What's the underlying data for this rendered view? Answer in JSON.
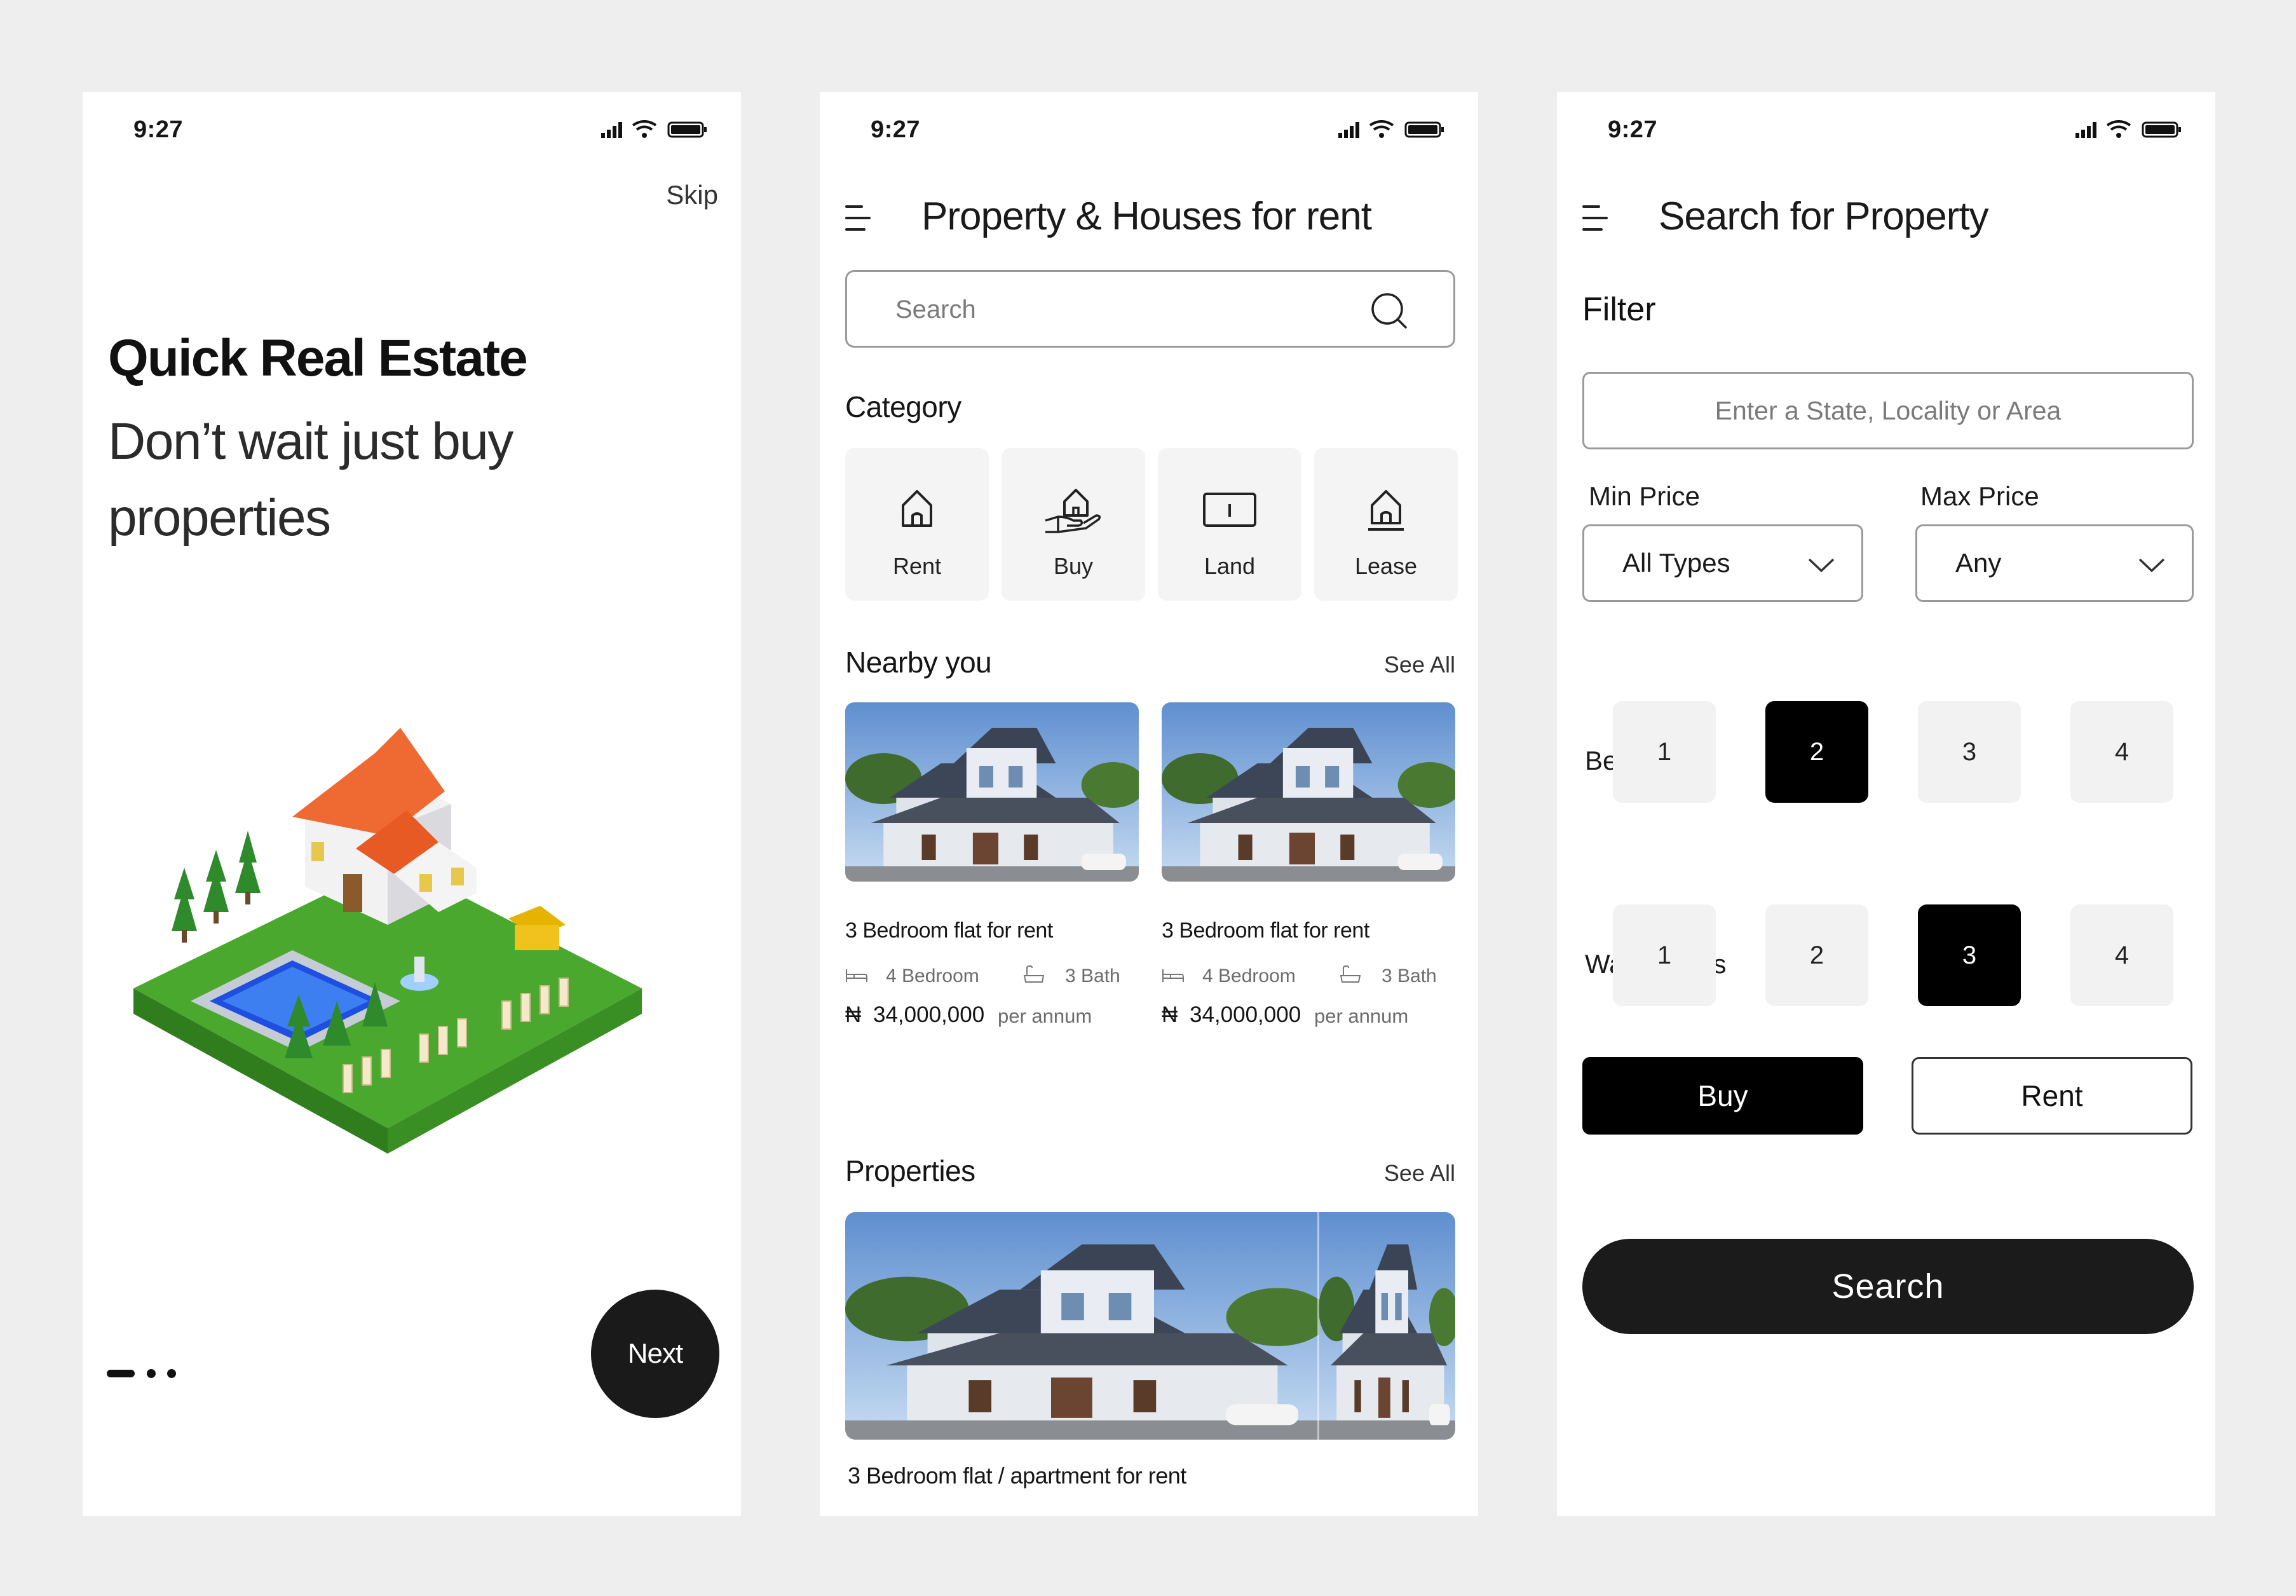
{
  "onboarding": {
    "time": "9:27",
    "skip_label": "Skip",
    "title": "Quick Real Estate",
    "subtitle": "Don’t wait just buy properties",
    "next_label": "Next",
    "page_indicator": {
      "current": 1,
      "total": 3
    }
  },
  "listing": {
    "time": "9:27",
    "title": "Property & Houses for rent",
    "search_placeholder": "Search",
    "category_title": "Category",
    "categories": [
      {
        "label": "Rent",
        "icon": "house-icon"
      },
      {
        "label": "Buy",
        "icon": "hand-house-icon"
      },
      {
        "label": "Land",
        "icon": "land-icon"
      },
      {
        "label": "Lease",
        "icon": "lease-house-icon"
      }
    ],
    "nearby_title": "Nearby you",
    "nearby_see_all": "See All",
    "nearby": [
      {
        "title": "3 Bedroom flat for rent",
        "bedrooms": "4 Bedroom",
        "baths": "3 Bath",
        "currency": "₦",
        "price": "34,000,000",
        "period": "per annum"
      },
      {
        "title": "3 Bedroom flat for rent",
        "bedrooms": "4 Bedroom",
        "baths": "3 Bath",
        "currency": "₦",
        "price": "34,000,000",
        "period": "per annum"
      }
    ],
    "properties_title": "Properties",
    "properties_see_all": "See All",
    "property_title": "3 Bedroom flat / apartment for rent"
  },
  "search": {
    "time": "9:27",
    "title": "Search for Property",
    "filter_label": "Filter",
    "location_placeholder": "Enter a State, Locality or Area",
    "min_price_label": "Min Price",
    "min_price_value": "All Types",
    "max_price_label": "Max Price",
    "max_price_value": "Any",
    "bedrooms_label": "Bedrooms",
    "bedrooms": [
      "1",
      "2",
      "3",
      "4"
    ],
    "bedrooms_selected": "2",
    "washrooms_label": "Washrooms",
    "washrooms": [
      "1",
      "2",
      "3",
      "4"
    ],
    "washrooms_selected": "3",
    "buy_label": "Buy",
    "rent_label": "Rent",
    "search_label": "Search"
  }
}
